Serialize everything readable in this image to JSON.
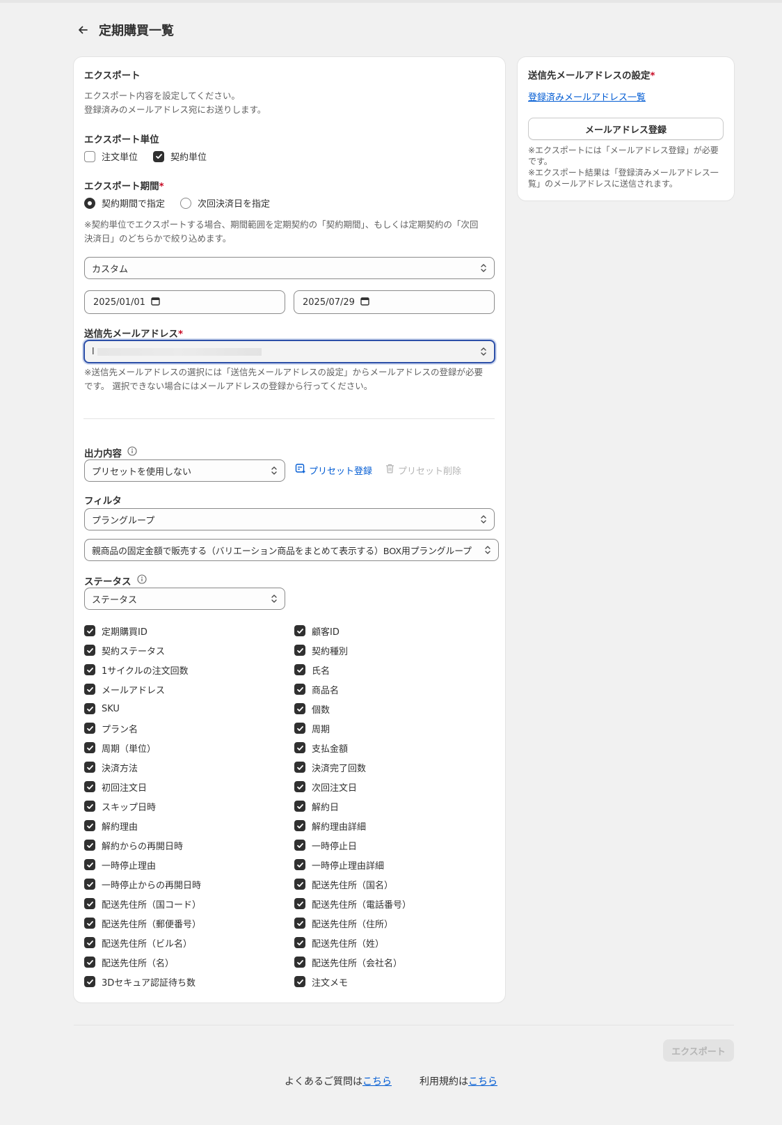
{
  "page": {
    "title": "定期購買一覧"
  },
  "export": {
    "title": "エクスポート",
    "desc_line1": "エクスポート内容を設定してください。",
    "desc_line2": "登録済みのメールアドレス宛にお送りします。",
    "unit": {
      "label": "エクスポート単位",
      "options": [
        {
          "label": "注文単位",
          "checked": false
        },
        {
          "label": "契約単位",
          "checked": true
        }
      ]
    },
    "period": {
      "label": "エクスポート期間",
      "required_mark": "*",
      "options": [
        {
          "label": "契約期間で指定",
          "selected": true
        },
        {
          "label": "次回決済日を指定",
          "selected": false
        }
      ],
      "note_line1": "※契約単位でエクスポートする場合、期間範囲を定期契約の「契約期間」、もしくは定期契約の「次回",
      "note_line2": "決済日」のどちらかで絞り込めます。",
      "range_select": "カスタム",
      "start_date": "2025/01/01",
      "end_date": "2025/07/29"
    },
    "email": {
      "label": "送信先メールアドレス",
      "required_mark": "*",
      "value": "l",
      "note_line1": "※送信先メールアドレスの選択には「送信先メールアドレスの設定」からメールアドレスの登録が必要",
      "note_line2": "です。 選択できない場合にはメールアドレスの登録から行ってください。"
    },
    "output": {
      "label": "出力内容",
      "preset_select": "プリセットを使用しない",
      "preset_register": "プリセット登録",
      "preset_delete": "プリセット削除"
    },
    "filter": {
      "label": "フィルタ",
      "type_select": "プラングループ",
      "value_select": "親商品の固定金額で販売する（バリエーション商品をまとめて表示する）BOX用プラングループ"
    },
    "status": {
      "label": "ステータス",
      "select": "ステータス"
    },
    "fields_left": [
      "定期購買ID",
      "契約ステータス",
      "1サイクルの注文回数",
      "メールアドレス",
      "SKU",
      "プラン名",
      "周期（単位）",
      "決済方法",
      "初回注文日",
      "スキップ日時",
      "解約理由",
      "解約からの再開日時",
      "一時停止理由",
      "一時停止からの再開日時",
      "配送先住所（国コード）",
      "配送先住所（郵便番号）",
      "配送先住所（ビル名）",
      "配送先住所（名）",
      "3Dセキュア認証待ち数"
    ],
    "fields_right": [
      "顧客ID",
      "契約種別",
      "氏名",
      "商品名",
      "個数",
      "周期",
      "支払金額",
      "決済完了回数",
      "次回注文日",
      "解約日",
      "解約理由詳細",
      "一時停止日",
      "一時停止理由詳細",
      "配送先住所（国名）",
      "配送先住所（電話番号）",
      "配送先住所（住所）",
      "配送先住所（姓）",
      "配送先住所（会社名）",
      "注文メモ"
    ]
  },
  "side": {
    "title": "送信先メールアドレスの設定",
    "required_mark": "*",
    "list_link": "登録済みメールアドレス一覧",
    "register_button": "メールアドレス登録",
    "note1_line1": "※エクスポートには「メールアドレス登録」が必要",
    "note1_line2": "です。",
    "note2_line1": "※エクスポート結果は「登録済みメールアドレス一",
    "note2_line2": "覧」のメールアドレスに送信されます。"
  },
  "actions": {
    "export_button": "エクスポート"
  },
  "footer": {
    "faq_prefix": "よくあるご質問は",
    "faq_link": "こちら",
    "terms_prefix": "利用規約は",
    "terms_link": "こちら"
  },
  "colors": {
    "accent_link": "#005bd3",
    "required": "#c70a24",
    "checkbox": "#303030",
    "focus": "#2c4fa8"
  }
}
